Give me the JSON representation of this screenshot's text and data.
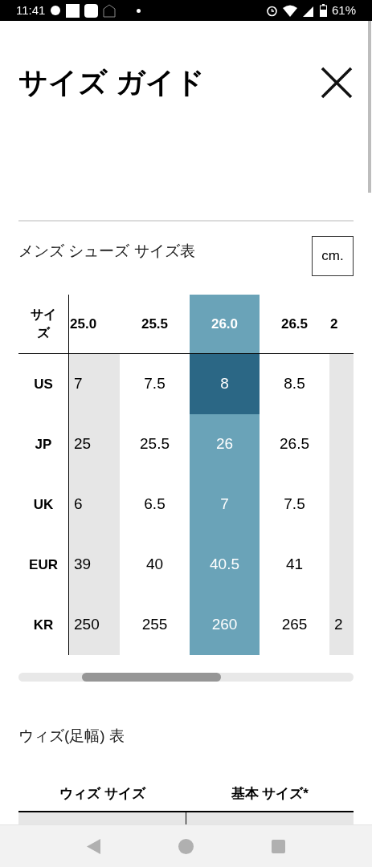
{
  "status_bar": {
    "time": "11:41",
    "battery": "61%"
  },
  "title": "サイズ ガイド",
  "size_chart": {
    "heading": "メンズ シューズ サイズ表",
    "unit_button": "cm.",
    "corner_label": "サイズ",
    "columns": [
      {
        "size": "25.0",
        "selected": false
      },
      {
        "size": "25.5",
        "selected": false
      },
      {
        "size": "26.0",
        "selected": true
      },
      {
        "size": "26.5",
        "selected": false
      },
      {
        "size": "2",
        "selected": false
      }
    ],
    "rows": [
      {
        "label": "US",
        "selected": true,
        "cells": [
          "7",
          "7.5",
          "8",
          "8.5"
        ]
      },
      {
        "label": "JP",
        "selected": false,
        "cells": [
          "25",
          "25.5",
          "26",
          "26.5"
        ]
      },
      {
        "label": "UK",
        "selected": false,
        "cells": [
          "6",
          "6.5",
          "7",
          "7.5"
        ]
      },
      {
        "label": "EUR",
        "selected": false,
        "cells": [
          "39",
          "40",
          "40.5",
          "41"
        ]
      },
      {
        "label": "KR",
        "selected": false,
        "cells": [
          "250",
          "255",
          "260",
          "265",
          "2"
        ]
      }
    ]
  },
  "width_chart": {
    "heading": "ウィズ(足幅) 表",
    "columns": [
      "ウィズ サイズ",
      "基本 サイズ*"
    ]
  }
}
